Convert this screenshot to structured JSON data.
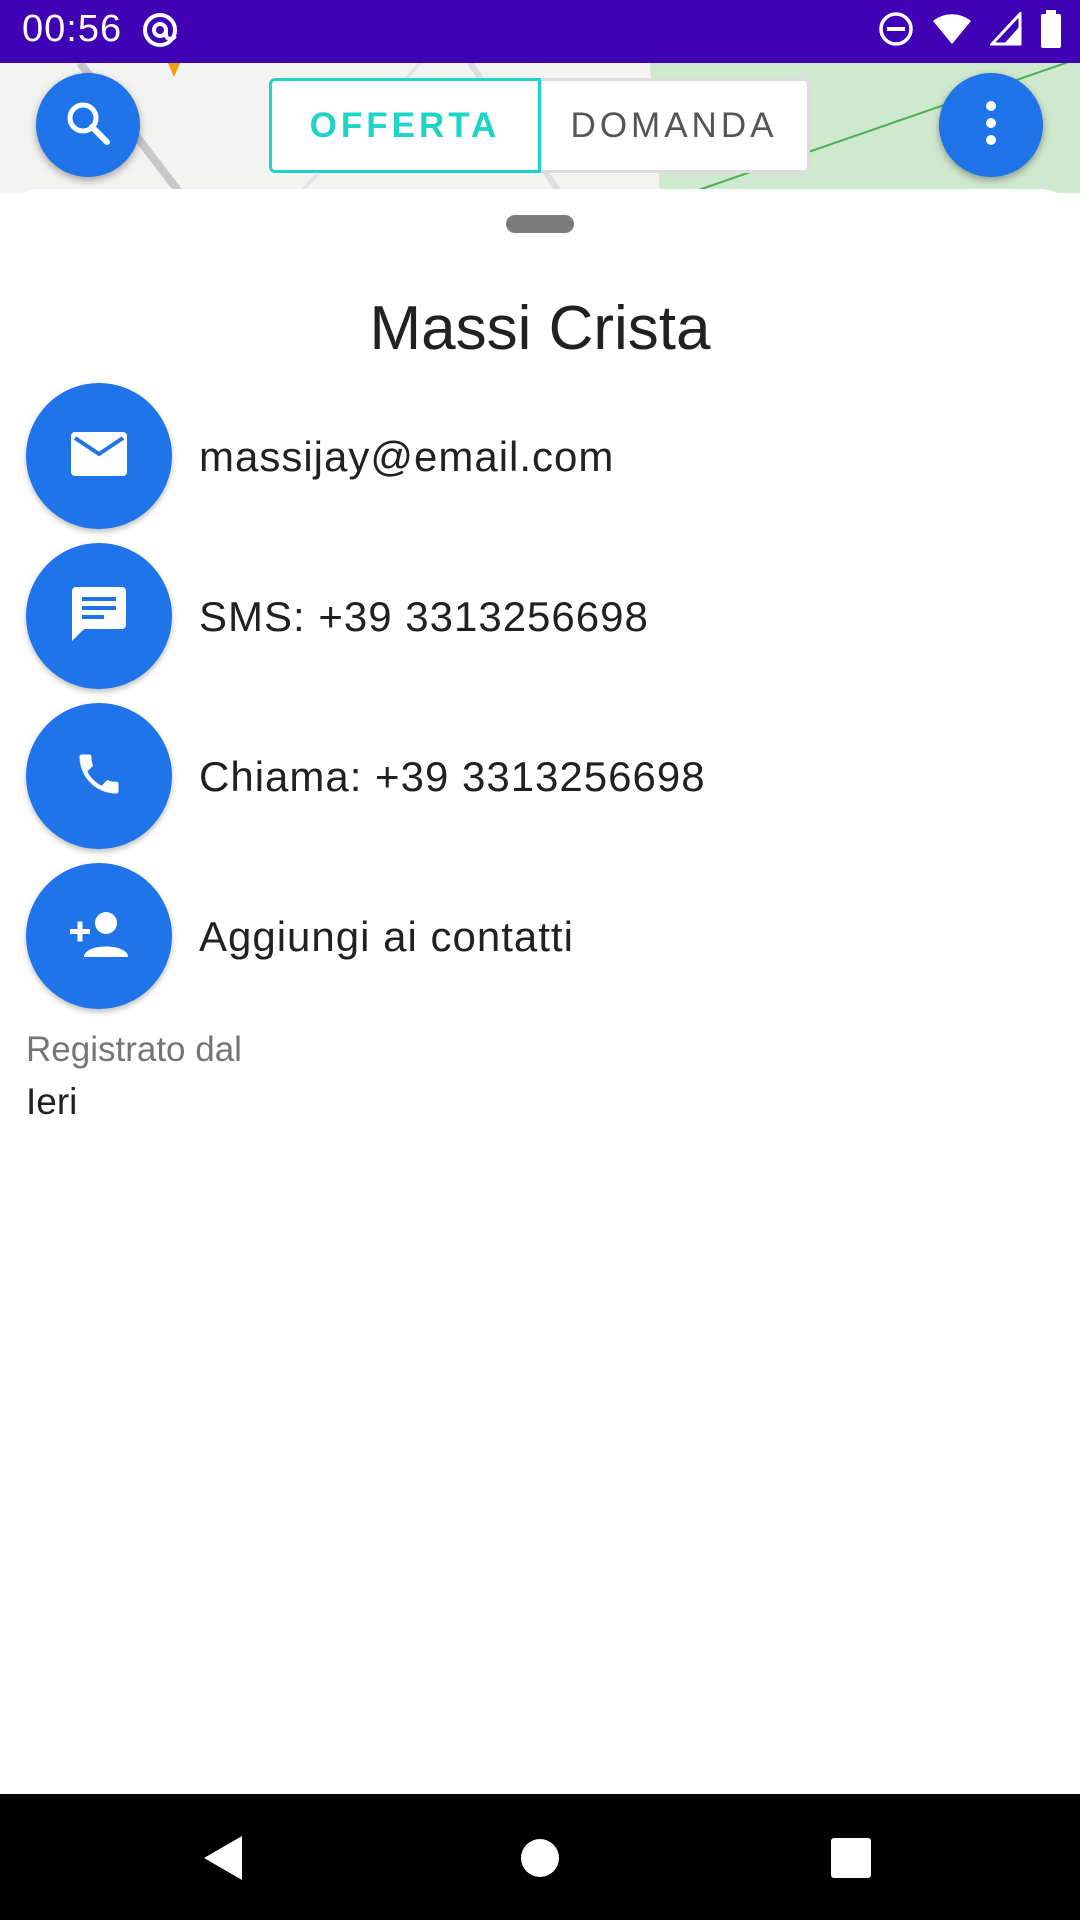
{
  "status_bar": {
    "time": "00:56",
    "icons": [
      "at-sign-icon",
      "do-not-disturb-icon",
      "wifi-icon",
      "signal-icon",
      "battery-icon"
    ]
  },
  "top_bar": {
    "search_icon": "search-icon",
    "menu_icon": "more-vert-icon",
    "tabs": [
      {
        "label": "OFFERTA",
        "selected": true
      },
      {
        "label": "DOMANDA",
        "selected": false
      }
    ]
  },
  "contact": {
    "name": "Massi Crista",
    "actions": [
      {
        "icon": "email-icon",
        "label": "massijay@email.com"
      },
      {
        "icon": "sms-icon",
        "label": "SMS: +39 3313256698"
      },
      {
        "icon": "phone-icon",
        "label": "Chiama: +39 3313256698"
      },
      {
        "icon": "person-add-icon",
        "label": "Aggiungi ai contatti"
      }
    ],
    "registered_label": "Registrato dal",
    "registered_value": "Ieri"
  },
  "colors": {
    "status_bar": "#3f02b5",
    "accent": "#1e74e8",
    "tab_selected": "#1ed3c8"
  }
}
